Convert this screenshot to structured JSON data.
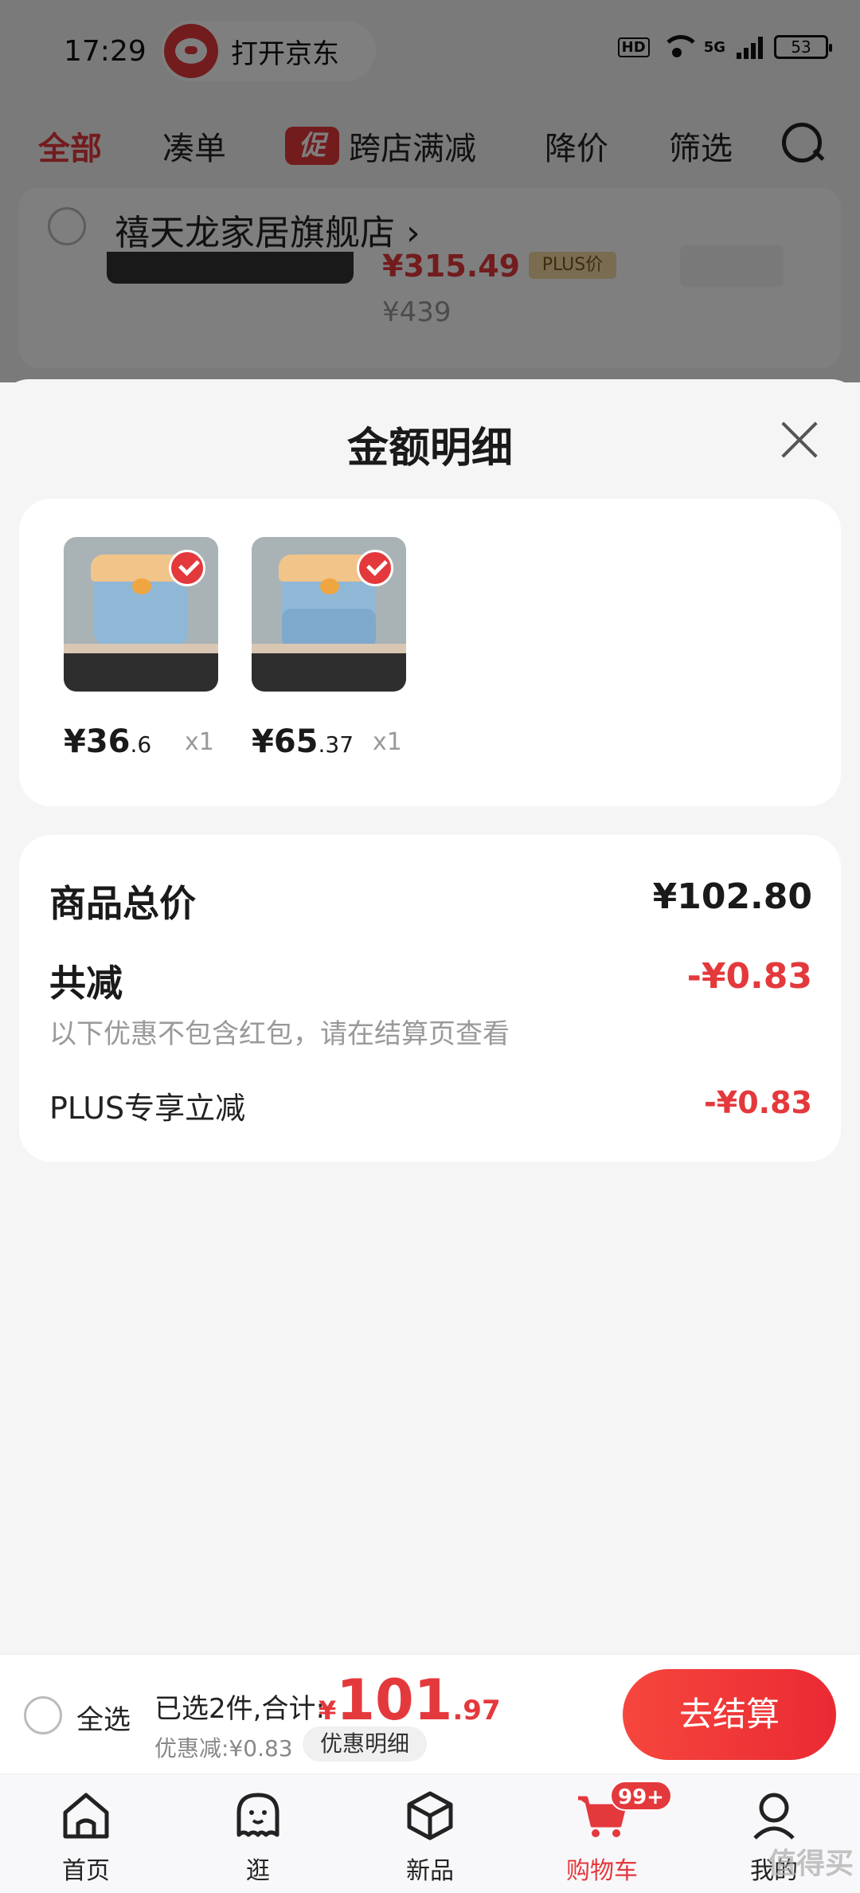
{
  "status_bar": {
    "time": "17:29",
    "open_app_label": "打开京东",
    "hd": "HD",
    "network": "5G",
    "battery": "53"
  },
  "filter_tabs": {
    "all": "全部",
    "coudan": "凑单",
    "cu_badge": "促",
    "cross_store": "跨店满减",
    "price_drop": "降价",
    "filter": "筛选"
  },
  "store": {
    "name": "禧天龙家居旗舰店",
    "chevron": "›",
    "price": "¥315.49",
    "plus_tag": "PLUS价",
    "old_price": "¥439"
  },
  "sheet": {
    "title": "金额明细",
    "items": [
      {
        "price_int": "¥36",
        "price_dec": ".6",
        "qty": "x1"
      },
      {
        "price_int": "¥65",
        "price_dec": ".37",
        "qty": "x1"
      }
    ],
    "total_label": "商品总价",
    "total_value": "¥102.80",
    "reduce_label": "共减",
    "reduce_value": "-¥0.83",
    "note": "以下优惠不包含红包，请在结算页查看",
    "plus_label": "PLUS专享立减",
    "plus_value": "-¥0.83"
  },
  "checkout": {
    "select_all": "全选",
    "selected_summary": "已选2件,合计:",
    "currency": "¥",
    "total_int": "101",
    "total_dec": ".97",
    "discount_text": "优惠减:¥0.83",
    "discount_detail": "优惠明细",
    "checkout_button": "去结算"
  },
  "nav": {
    "home": "首页",
    "browse": "逛",
    "new": "新品",
    "cart": "购物车",
    "cart_badge": "99+",
    "me": "我的"
  },
  "watermark": "值得买",
  "colors": {
    "accent": "#e4393c",
    "background": "#f5f5f5"
  }
}
